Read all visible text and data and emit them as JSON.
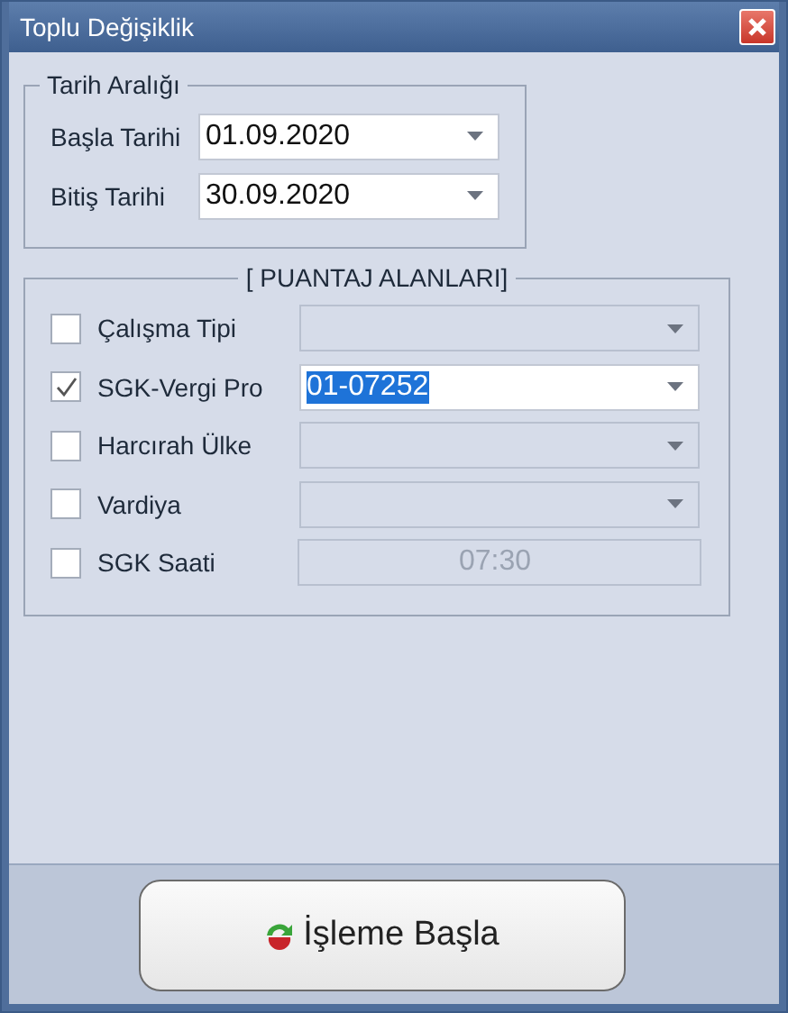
{
  "window": {
    "title": "Toplu Değişiklik"
  },
  "date_range": {
    "title": "Tarih Aralığı",
    "fields": [
      {
        "label": "Başla Tarihi",
        "value": "01.09.2020"
      },
      {
        "label": "Bitiş Tarihi",
        "value": "30.09.2020"
      }
    ]
  },
  "fields_group": {
    "title": "[ PUANTAJ ALANLARI]",
    "rows": [
      {
        "label": "Çalışma Tipi",
        "checked": false,
        "kind": "combo"
      },
      {
        "label": "SGK-Vergi Pro",
        "checked": true,
        "kind": "combo",
        "value": "01-07252",
        "text_selected": true
      },
      {
        "label": "Harcırah Ülke",
        "checked": false,
        "kind": "combo"
      },
      {
        "label": "Vardiya",
        "checked": false,
        "kind": "combo"
      },
      {
        "label": "SGK Saati",
        "checked": false,
        "kind": "text",
        "value": "07:30",
        "text_selected": false
      }
    ]
  },
  "start_button": {
    "label": "İşleme Başla"
  }
}
